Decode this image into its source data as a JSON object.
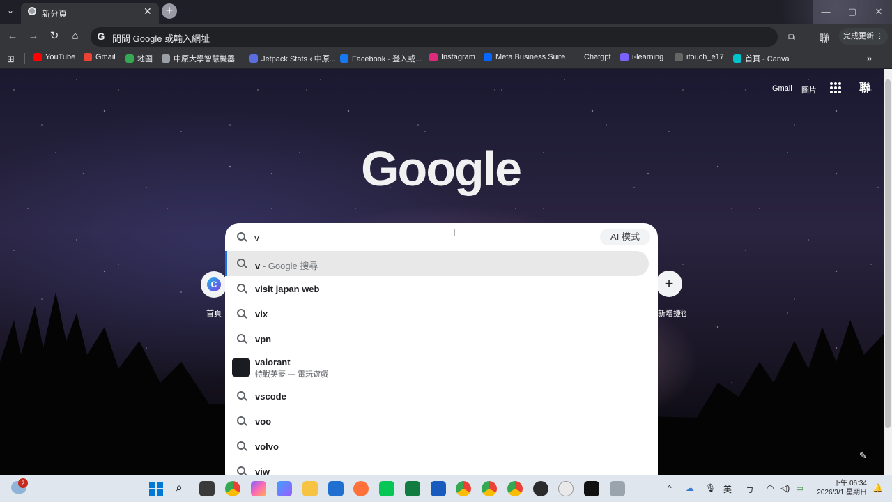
{
  "browser": {
    "tab": {
      "title": "新分頁",
      "close": "✕",
      "menu": "⌄"
    },
    "new_tab": "+",
    "window_controls": {
      "minimize": "—",
      "maximize": "▢",
      "close": "✕"
    },
    "omnibox_placeholder": "問問 Google 或輸入網址",
    "omnibox_logo": "G",
    "profile_label": "聯",
    "update_button": "完成更新",
    "more": "⋮"
  },
  "bookmarks": [
    {
      "label": "YouTube",
      "icon": "youtube-icon",
      "color": "#ff0000"
    },
    {
      "label": "Gmail",
      "icon": "gmail-icon",
      "color": "#ea4335"
    },
    {
      "label": "地圖",
      "icon": "maps-icon",
      "color": "#34a853"
    },
    {
      "label": "中原大學智慧機器...",
      "icon": "globe-icon",
      "color": "#9aa0a6"
    },
    {
      "label": "Jetpack Stats ‹ 中原...",
      "icon": "wordpress-icon",
      "color": "#5b6ee1"
    },
    {
      "label": "Facebook - 登入或...",
      "icon": "facebook-icon",
      "color": "#1877f2"
    },
    {
      "label": "Instagram",
      "icon": "instagram-icon",
      "color": "#dd2a7b"
    },
    {
      "label": "Meta Business Suite",
      "icon": "meta-icon",
      "color": "#0866ff"
    },
    {
      "label": "Chatgpt",
      "icon": "",
      "color": ""
    },
    {
      "label": "i-learning",
      "icon": "m-icon",
      "color": "#7b61ff"
    },
    {
      "label": "itouch_e17",
      "icon": "a-icon",
      "color": "#666"
    },
    {
      "label": "首頁 - Canva",
      "icon": "canva-icon",
      "color": "#00c4cc"
    }
  ],
  "bookmarks_more": "»",
  "page": {
    "logo": "Google",
    "top_links": {
      "gmail": "Gmail",
      "images": "圖片"
    },
    "avatar": "聯",
    "shortcut_c_label": "首頁",
    "shortcut_c_letter": "C",
    "shortcut_add_label": "新增捷徑",
    "shortcut_add": "+",
    "edit": "✎",
    "cursor": "I"
  },
  "search": {
    "value": "v",
    "ai_mode": "AI 模式",
    "suggestions": [
      {
        "bold": "v",
        "light": " - Google 搜尋",
        "selected": true
      },
      {
        "bold": "visit japan web",
        "light": ""
      },
      {
        "bold": "vix",
        "light": ""
      },
      {
        "bold": "vpn",
        "light": ""
      },
      {
        "bold": "vscode",
        "light": ""
      },
      {
        "bold": "voo",
        "light": ""
      },
      {
        "bold": "volvo",
        "light": ""
      },
      {
        "bold": "viw",
        "light": ""
      }
    ],
    "entity": {
      "title": "valorant",
      "subtitle": "特戰英豪 — 電玩遊戲"
    }
  },
  "taskbar": {
    "notification_count": "2",
    "ime": "英",
    "ime2": "ㄅ",
    "time": "下午 06:34",
    "date": "2026/3/1 星期日",
    "hidden_icons": "^"
  }
}
